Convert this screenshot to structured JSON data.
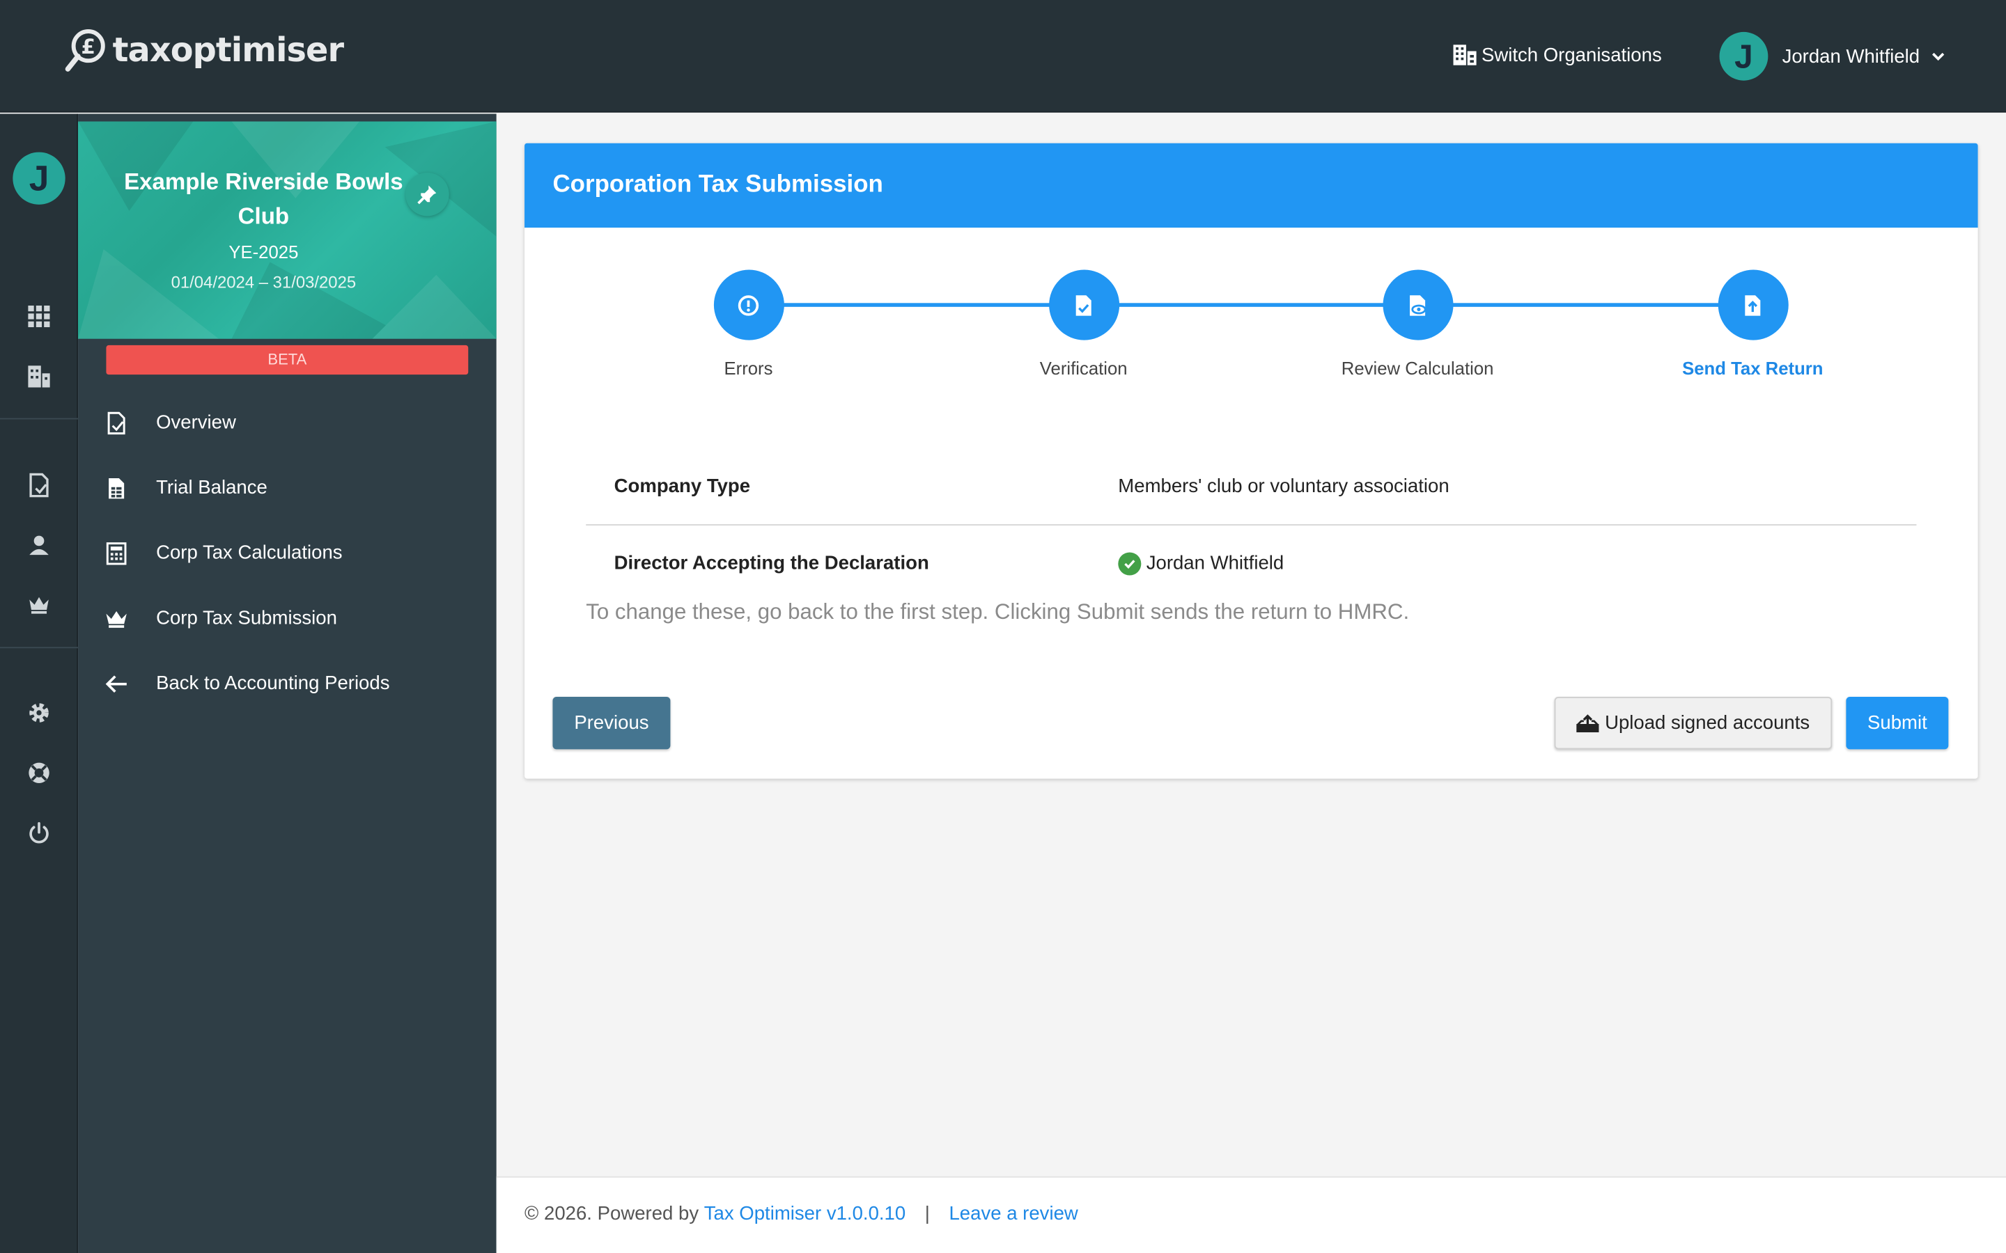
{
  "brand": {
    "name": "taxoptimiser"
  },
  "topbar": {
    "switch_org": "Switch Organisations",
    "user_initial": "J",
    "user_name": "Jordan Whitfield"
  },
  "rail": {
    "avatar_initial": "J"
  },
  "org": {
    "name": "Example Riverside Bowls Club",
    "year": "YE-2025",
    "dates": "01/04/2024 – 31/03/2025",
    "badge": "BETA"
  },
  "nav": [
    {
      "label": "Overview",
      "icon": "document-check-icon"
    },
    {
      "label": "Trial Balance",
      "icon": "spreadsheet-icon"
    },
    {
      "label": "Corp Tax Calculations",
      "icon": "calculator-icon"
    },
    {
      "label": "Corp Tax Submission",
      "icon": "crown-icon"
    },
    {
      "label": "Back to Accounting Periods",
      "icon": "arrow-left-icon"
    }
  ],
  "card": {
    "title": "Corporation Tax Submission",
    "steps": [
      {
        "label": "Errors",
        "icon": "alert-icon",
        "active": false
      },
      {
        "label": "Verification",
        "icon": "document-check-icon",
        "active": false
      },
      {
        "label": "Review Calculation",
        "icon": "document-eye-icon",
        "active": false
      },
      {
        "label": "Send Tax Return",
        "icon": "file-upload-icon",
        "active": true
      }
    ],
    "rows": [
      {
        "key": "Company Type",
        "value": "Members' club or voluntary association"
      },
      {
        "key": "Director Accepting the Declaration",
        "value": "Jordan Whitfield"
      }
    ],
    "note": "To change these, go back to the first step. Clicking Submit sends the return to HMRC.",
    "buttons": {
      "previous": "Previous",
      "upload": "Upload signed accounts",
      "submit": "Submit"
    }
  },
  "footer": {
    "copyright": "© 2026. Powered by ",
    "product_link": "Tax Optimiser v1.0.0.10",
    "separator": "|",
    "review_link": "Leave a review"
  },
  "colors": {
    "topbar": "#263238",
    "sidebar": "#2f3e46",
    "accent": "#2196f3",
    "teal": "#26a69a",
    "beta": "#ef5350"
  }
}
